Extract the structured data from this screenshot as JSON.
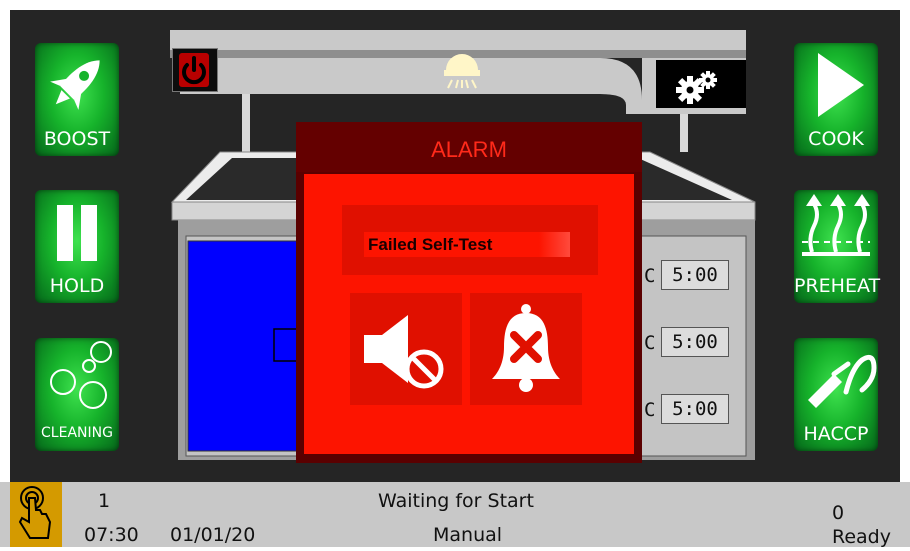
{
  "side_buttons": {
    "boost": "BOOST",
    "hold": "HOLD",
    "cleaning": "CLEANING",
    "cook": "COOK",
    "preheat": "PREHEAT",
    "haccp": "HACCP"
  },
  "baskets": [
    {
      "unit": "C",
      "time": "5:00"
    },
    {
      "unit": "C",
      "time": "5:00"
    },
    {
      "unit": "C",
      "time": "5:00"
    }
  ],
  "alarm": {
    "title": "ALARM",
    "message": "Failed Self-Test",
    "buttons": [
      "mute-sound",
      "acknowledge-alarm"
    ]
  },
  "status": {
    "slot": "1",
    "time": "07:30",
    "date": "01/01/20",
    "state": "Waiting for Start",
    "mode": "Manual",
    "count": "0",
    "ready": "Ready"
  },
  "colors": {
    "background": "#252525",
    "button_green": "#16b32b",
    "alarm_red": "#fd1400",
    "alarm_title": "#ff2a1a",
    "basket_blue": "#0000ff",
    "status_bar": "#c8c8c8"
  },
  "icons": [
    "power-icon",
    "light-icon",
    "settings-gears-icon",
    "rocket-icon",
    "pause-icon",
    "bubbles-icon",
    "play-icon",
    "heat-arrows-icon",
    "probe-icon",
    "touch-hand-icon",
    "speaker-mute-icon",
    "bell-cancel-icon"
  ]
}
